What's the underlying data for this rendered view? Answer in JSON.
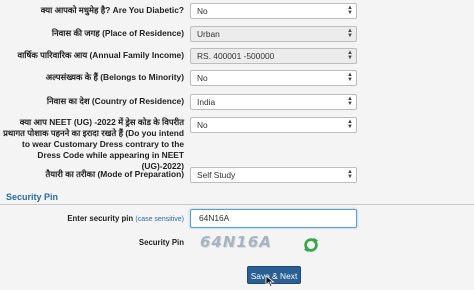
{
  "fields": [
    {
      "label": "क्या आपको मधुमेह है? Are You Diabetic?",
      "value": "No",
      "readonly": false
    },
    {
      "label": "निवास की जगह (Place of Residence)",
      "value": "Urban",
      "readonly": true
    },
    {
      "label": "वार्षिक पारिवारिक आय (Annual Family Income)",
      "value": "RS. 400001 -500000",
      "readonly": true
    },
    {
      "label": "अल्पसंख्यक के हैं (Belongs to Minority)",
      "value": "No",
      "readonly": false
    },
    {
      "label": "निवास का देश (Country of Residence)",
      "value": "India",
      "readonly": false
    },
    {
      "label": "क्या आप NEET (UG) -2022 में ड्रेस कोड के विपरीत प्रथागत पोशाक पहनने का इरादा रखते हैं (Do you intend to wear Customary Dress contrary to the Dress Code while appearing in NEET (UG)-2022)",
      "value": "No",
      "readonly": false
    },
    {
      "label": "तैयारी का तरीका (Mode of Preparation)",
      "value": "Self Study",
      "readonly": false
    }
  ],
  "security": {
    "section_title": "Security Pin",
    "pin_label": "Enter security pin",
    "pin_hint": "(case sensitive)",
    "pin_value": "64N16A",
    "captcha_label": "Security Pin",
    "captcha_text": "64N16A",
    "refresh_icon": "refresh-icon"
  },
  "submit_label": "Save & Next",
  "colors": {
    "accent": "#2b6aa8",
    "button": "#2a5f95",
    "refresh": "#3aa64a"
  }
}
